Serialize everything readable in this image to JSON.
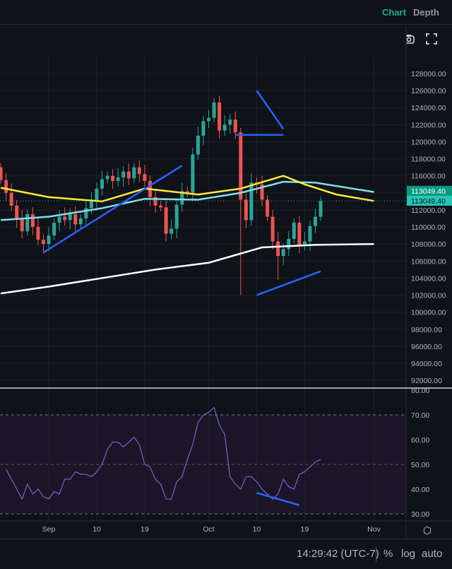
{
  "header": {
    "tabs": [
      {
        "label": "Chart",
        "active": true
      },
      {
        "label": "Depth",
        "active": false
      }
    ]
  },
  "toolbar": {
    "icons": [
      "gear-icon",
      "camera-icon",
      "fullscreen-icon"
    ]
  },
  "footer": {
    "time": "14:29:42 (UTC-7)",
    "percent": "%",
    "log": "log",
    "auto": "auto"
  },
  "colors": {
    "up": "#26a69a",
    "down": "#ef5350",
    "ma_fast": "#ffeb3b",
    "ma_mid": "#80deea",
    "ma_slow": "#ffffff",
    "drawing": "#2962ff",
    "rsi": "#7e57c2",
    "label_a": "#089981",
    "label_b": "#22c7b8"
  },
  "chart_data": [
    {
      "type": "candlestick",
      "title": "Price",
      "ylim": [
        91000,
        130000
      ],
      "y_ticks": [
        "128000.00",
        "126000.00",
        "124000.00",
        "122000.00",
        "120000.00",
        "118000.00",
        "116000.00",
        "114000.00",
        "112000.00",
        "110000.00",
        "108000.00",
        "106000.00",
        "104000.00",
        "102000.00",
        "100000.00",
        "98000.00",
        "96000.00",
        "94000.00",
        "92000.00"
      ],
      "y_tick_values": [
        128000,
        126000,
        124000,
        122000,
        120000,
        118000,
        116000,
        114000,
        112000,
        110000,
        108000,
        106000,
        104000,
        102000,
        100000,
        98000,
        96000,
        94000,
        92000
      ],
      "x_ticks": [
        {
          "label": "Sep",
          "day": 0
        },
        {
          "label": "10",
          "day": 9
        },
        {
          "label": "19",
          "day": 18
        },
        {
          "label": "Oct",
          "day": 30
        },
        {
          "label": "10",
          "day": 39
        },
        {
          "label": "19",
          "day": 48
        },
        {
          "label": "Nov",
          "day": 61
        }
      ],
      "start_day": -9,
      "open0": 117000,
      "closes": [
        115500,
        114000,
        112500,
        111000,
        109500,
        111500,
        110000,
        108500,
        108000,
        109000,
        110500,
        111200,
        110800,
        111500,
        110300,
        111000,
        112200,
        113000,
        114500,
        115600,
        116000,
        115400,
        115800,
        116500,
        115700,
        117000,
        116200,
        115400,
        113500,
        112500,
        112300,
        109200,
        109800,
        112600,
        114200,
        114000,
        118500,
        120700,
        122400,
        122800,
        124600,
        121300,
        122000,
        122600,
        121100,
        113200,
        110800,
        115200,
        115000,
        113200,
        111200,
        108300,
        106600,
        107400,
        108600,
        110500,
        107900,
        108300,
        110100,
        111200,
        113049.4
      ],
      "wick_low_extra": {
        "45": 102000,
        "52": 103800
      },
      "ma_fast": [
        {
          "day": -9,
          "v": 114600
        },
        {
          "day": 0,
          "v": 113500
        },
        {
          "day": 10,
          "v": 113000
        },
        {
          "day": 18,
          "v": 114500
        },
        {
          "day": 28,
          "v": 113800
        },
        {
          "day": 36,
          "v": 114500
        },
        {
          "day": 44,
          "v": 116000
        },
        {
          "day": 48,
          "v": 115000
        },
        {
          "day": 54,
          "v": 113800
        },
        {
          "day": 61,
          "v": 113049.4
        }
      ],
      "ma_mid": [
        {
          "day": -9,
          "v": 110800
        },
        {
          "day": 0,
          "v": 111200
        },
        {
          "day": 10,
          "v": 112200
        },
        {
          "day": 18,
          "v": 113300
        },
        {
          "day": 28,
          "v": 113200
        },
        {
          "day": 36,
          "v": 114000
        },
        {
          "day": 44,
          "v": 115300
        },
        {
          "day": 50,
          "v": 115200
        },
        {
          "day": 61,
          "v": 114100
        }
      ],
      "ma_slow": [
        {
          "day": -9,
          "v": 102200
        },
        {
          "day": 0,
          "v": 103000
        },
        {
          "day": 10,
          "v": 104000
        },
        {
          "day": 20,
          "v": 105000
        },
        {
          "day": 30,
          "v": 105800
        },
        {
          "day": 40,
          "v": 107600
        },
        {
          "day": 50,
          "v": 107900
        },
        {
          "day": 61,
          "v": 108000
        }
      ],
      "last_price_labels": [
        "113049.40",
        "113049.40"
      ],
      "drawings": [
        [
          [
            -1,
            107000
          ],
          [
            25,
            117200
          ]
        ],
        [
          [
            39,
            126000
          ],
          [
            44,
            121500
          ]
        ],
        [
          [
            35,
            120800
          ],
          [
            44,
            120800
          ]
        ],
        [
          [
            39,
            102000
          ],
          [
            51,
            104800
          ]
        ]
      ]
    },
    {
      "type": "line",
      "title": "RSI",
      "ylim": [
        28,
        80
      ],
      "y_ticks": [
        "80.00",
        "70.00",
        "60.00",
        "50.00",
        "40.00",
        "30.00"
      ],
      "y_tick_values": [
        80,
        70,
        60,
        50,
        40,
        30
      ],
      "band": [
        30,
        70
      ],
      "values": [
        48,
        44,
        40,
        36,
        42,
        38,
        40,
        37,
        36,
        39,
        38,
        44,
        44,
        47,
        46,
        46,
        45,
        47,
        50,
        56,
        59,
        59,
        57,
        59,
        61,
        58,
        50,
        49,
        44,
        42,
        36,
        36,
        43,
        45,
        52,
        58,
        67,
        70,
        71,
        73,
        66,
        62,
        45,
        42,
        40,
        45,
        45,
        43,
        40,
        38,
        36,
        38,
        44,
        41,
        40,
        46,
        47,
        49,
        51,
        52
      ],
      "rsi_start_day": -8,
      "drawing": [
        [
          39,
          38.5
        ],
        [
          47,
          33.5
        ]
      ]
    }
  ]
}
